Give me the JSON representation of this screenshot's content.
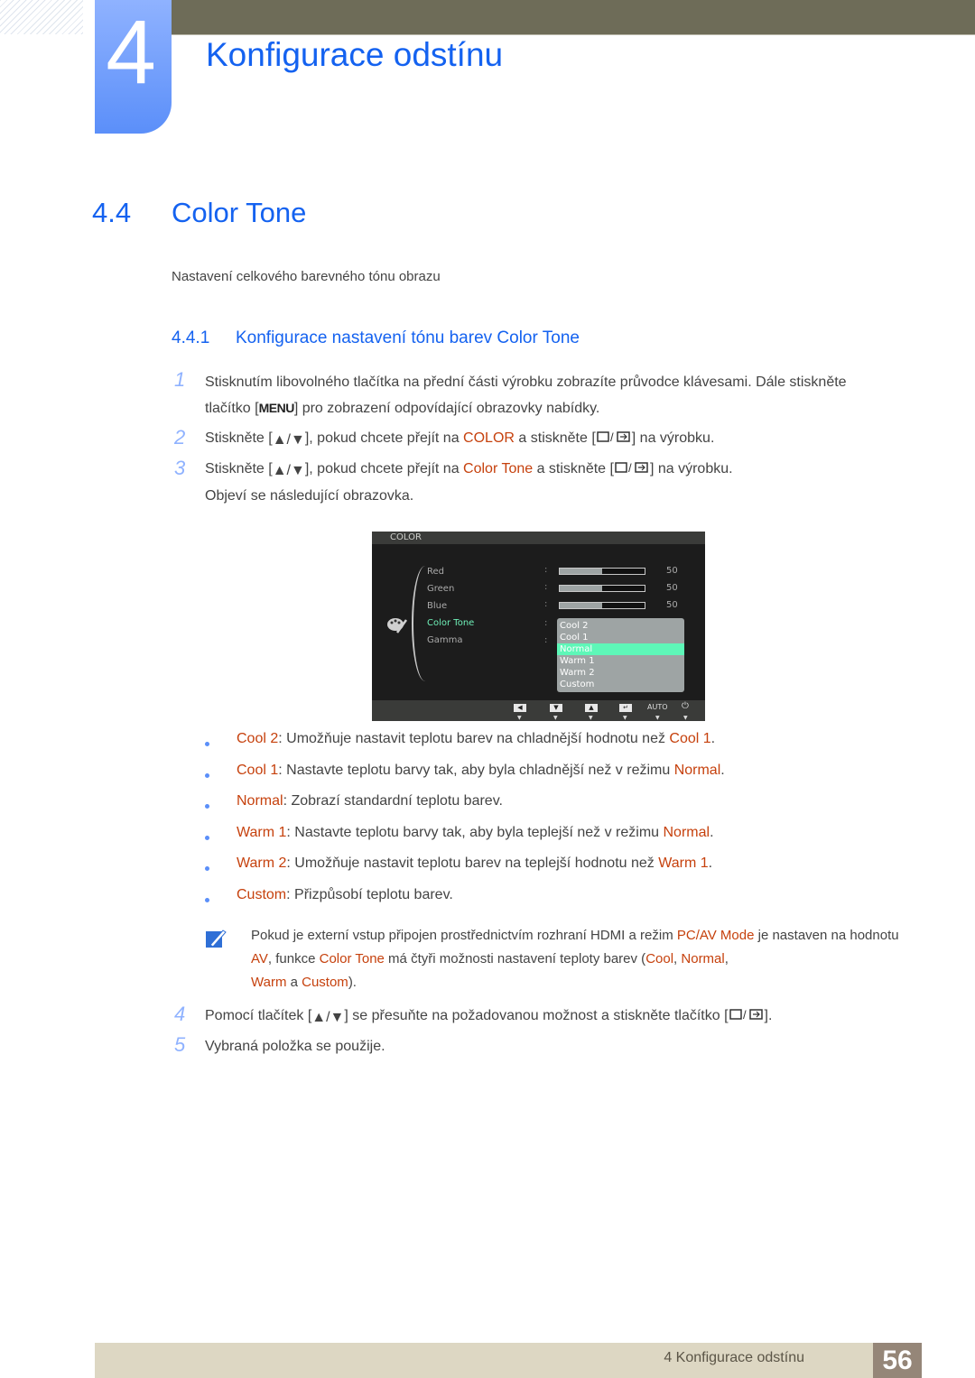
{
  "chapter": {
    "number": "4",
    "title": "Konfigurace odstínu"
  },
  "section": {
    "number": "4.4",
    "title": "Color Tone",
    "intro": "Nastavení celkového barevného tónu obrazu"
  },
  "subsection": {
    "number": "4.4.1",
    "title": "Konfigurace nastavení tónu barev Color Tone"
  },
  "steps": [
    {
      "num": "1",
      "parts": [
        "Stisknutím libovolného tlačítka na přední části výrobku zobrazíte průvodce klávesami. Dále stiskněte",
        "tlačítko [",
        "MENU",
        "] pro zobrazení odpovídající obrazovky nabídky."
      ]
    },
    {
      "num": "2",
      "pre": "Stiskněte [",
      "mid1": "], pokud chcete přejít na ",
      "hl": "COLOR",
      "mid2": " a stiskněte [",
      "post": "] na výrobku."
    },
    {
      "num": "3",
      "pre": "Stiskněte [",
      "mid1": "], pokud chcete přejít na ",
      "hl": "Color Tone",
      "mid2": " a stiskněte [",
      "post": "] na výrobku.",
      "extra": "Objeví se následující obrazovka."
    },
    {
      "num": "4",
      "pre": "Pomocí tlačítek [",
      "mid": "] se přesuňte na požadovanou možnost a stiskněte tlačítko [",
      "post": "]."
    },
    {
      "num": "5",
      "text": "Vybraná položka se použije."
    }
  ],
  "osd": {
    "header": "COLOR",
    "items": [
      {
        "label": "Red",
        "value": "50",
        "level": 0.5
      },
      {
        "label": "Green",
        "value": "50",
        "level": 0.5
      },
      {
        "label": "Blue",
        "value": "50",
        "level": 0.5
      },
      {
        "label": "Color Tone"
      },
      {
        "label": "Gamma"
      }
    ],
    "options": [
      "Cool 2",
      "Cool 1",
      "Normal",
      "Warm 1",
      "Warm 2",
      "Custom"
    ],
    "selected": "Normal",
    "footer_auto": "AUTO"
  },
  "bullets": [
    {
      "term": "Cool 2",
      "text": ": Umožňuje nastavit teplotu barev na chladnější hodnotu než ",
      "ref": "Cool 1",
      "end": "."
    },
    {
      "term": "Cool 1",
      "text": ": Nastavte teplotu barvy tak, aby byla chladnější než v režimu ",
      "ref": "Normal",
      "end": "."
    },
    {
      "term": "Normal",
      "text": ": Zobrazí standardní teplotu barev.",
      "ref": "",
      "end": ""
    },
    {
      "term": "Warm 1",
      "text": ": Nastavte teplotu barvy tak, aby byla teplejší než v režimu ",
      "ref": "Normal",
      "end": "."
    },
    {
      "term": "Warm 2",
      "text": ": Umožňuje nastavit teplotu barev na teplejší hodnotu než ",
      "ref": "Warm 1",
      "end": "."
    },
    {
      "term": "Custom",
      "text": ": Přizpůsobí teplotu barev.",
      "ref": "",
      "end": ""
    }
  ],
  "note": {
    "t1": "Pokud je externí vstup připojen prostřednictvím rozhraní HDMI a režim ",
    "h1": "PC/AV Mode",
    "t2": " je nastaven na hodnotu ",
    "h2": "AV",
    "t3": ", funkce ",
    "h3": "Color Tone",
    "t4": " má čtyři možnosti nastavení teploty barev (",
    "h4": "Cool",
    "t5": ", ",
    "h5": "Normal",
    "t6": ", ",
    "h6": "Warm",
    "t7": " a ",
    "h7": "Custom",
    "t8": ")."
  },
  "footer": {
    "title": "4 Konfigurace odstínu",
    "page": "56"
  },
  "colors": {
    "accent_blue": "#1462f0",
    "highlight": "#c6410d",
    "osd_selected": "#5ef7b8"
  }
}
